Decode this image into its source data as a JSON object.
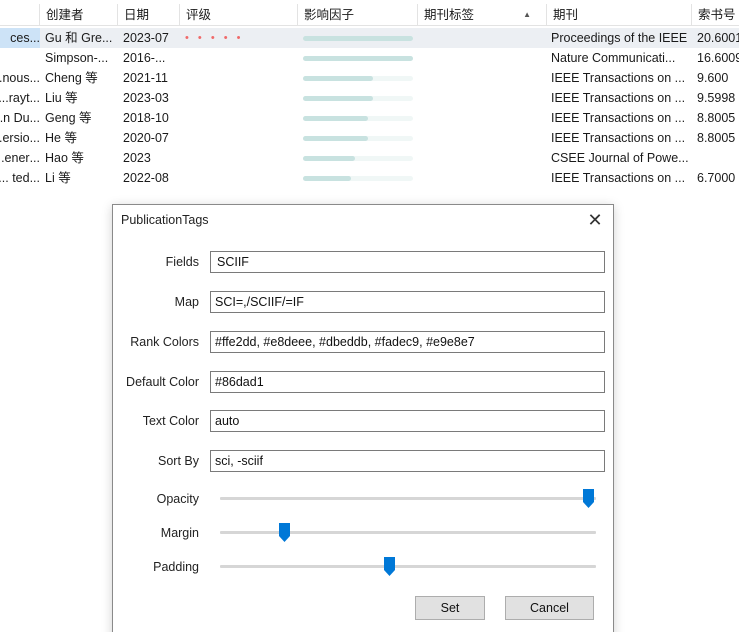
{
  "table": {
    "columns": [
      {
        "key": "title",
        "label": ""
      },
      {
        "key": "creator",
        "label": "创建者"
      },
      {
        "key": "date",
        "label": "日期"
      },
      {
        "key": "rating",
        "label": "评级"
      },
      {
        "key": "impact",
        "label": "影响因子"
      },
      {
        "key": "tags",
        "label": "期刊标签"
      },
      {
        "key": "journal",
        "label": "期刊"
      },
      {
        "key": "callno",
        "label": "索书号"
      }
    ],
    "sort_indicator": "▲",
    "rows": [
      {
        "title": "...ces",
        "creator": "Gu 和 Gre...",
        "date": "2023-07",
        "rating": "• • • • •",
        "impact_fraction": 1.0,
        "journal": "Proceedings of the IEEE",
        "callno": "20.6001"
      },
      {
        "title": "",
        "creator": "Simpson-...",
        "date": "2016-...",
        "rating": "",
        "impact_fraction": 1.0,
        "journal": "Nature Communicati...",
        "callno": "16.6009"
      },
      {
        "title": "...nous...",
        "creator": "Cheng 等",
        "date": "2021-11",
        "rating": "",
        "impact_fraction": 0.64,
        "journal": "IEEE Transactions on ...",
        "callno": "9.600"
      },
      {
        "title": "...rayt...",
        "creator": "Liu 等",
        "date": "2023-03",
        "rating": "",
        "impact_fraction": 0.64,
        "journal": "IEEE Transactions on ...",
        "callno": "9.5998"
      },
      {
        "title": "...n Du...",
        "creator": "Geng 等",
        "date": "2018-10",
        "rating": "",
        "impact_fraction": 0.59,
        "journal": "IEEE Transactions on ...",
        "callno": "8.8005"
      },
      {
        "title": "...ersio...",
        "creator": "He 等",
        "date": "2020-07",
        "rating": "",
        "impact_fraction": 0.59,
        "journal": "IEEE Transactions on ...",
        "callno": "8.8005"
      },
      {
        "title": "...ener...",
        "creator": "Hao 等",
        "date": "2023",
        "rating": "",
        "impact_fraction": 0.47,
        "journal": "CSEE Journal of Powe...",
        "callno": ""
      },
      {
        "title": "...ted ...",
        "creator": "Li 等",
        "date": "2022-08",
        "rating": "",
        "impact_fraction": 0.44,
        "journal": "IEEE Transactions on ...",
        "callno": "6.7000"
      }
    ]
  },
  "dialog": {
    "title": "PublicationTags",
    "close_glyph": "✕",
    "fields": [
      {
        "label": "Fields",
        "value": "SCIIF"
      },
      {
        "label": "Map",
        "value": "SCI=,/SCIIF/=IF"
      },
      {
        "label": "Rank Colors",
        "value": "#ffe2dd, #e8deee, #dbeddb, #fadec9, #e9e8e7"
      },
      {
        "label": "Default Color",
        "value": "#86dad1"
      },
      {
        "label": "Text Color",
        "value": "auto"
      },
      {
        "label": "Sort By",
        "value": "sci, -sciif"
      }
    ],
    "sliders": [
      {
        "label": "Opacity",
        "fraction": 0.98
      },
      {
        "label": "Margin",
        "fraction": 0.17
      },
      {
        "label": "Padding",
        "fraction": 0.45
      }
    ],
    "set_label": "Set",
    "cancel_label": "Cancel"
  },
  "colors": {
    "accent": "#0078d7",
    "rating_dots": "#f06a6a",
    "impact_bar": "#c8e2e0",
    "selected_row": "#eceff3"
  }
}
